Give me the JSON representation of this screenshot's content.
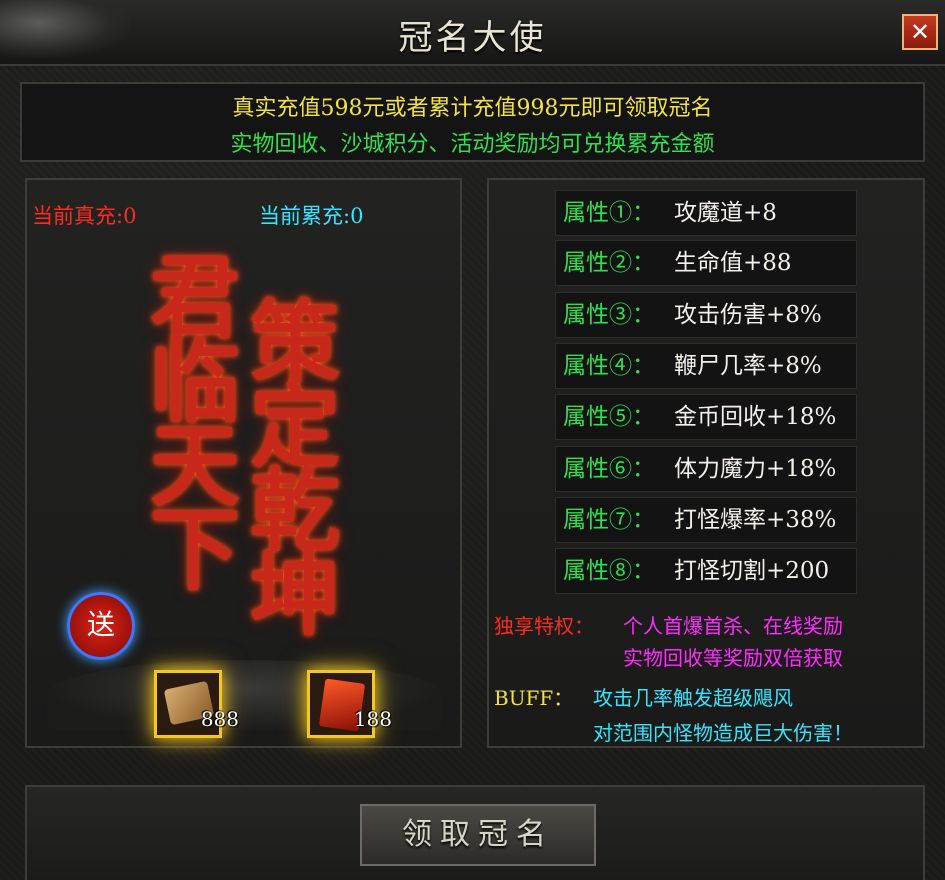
{
  "window": {
    "title": "冠名大使",
    "close_label": "✕"
  },
  "notice": {
    "line1": "真实充值598元或者累计充值998元即可领取冠名",
    "line2": "实物回收、沙城积分、活动奖励均可兑换累充金额"
  },
  "left_panel": {
    "current_real_recharge": "当前真充:0",
    "current_total_recharge": "当前累充:0",
    "calligraphy_line1": "君临天下",
    "calligraphy_line2": "策定乾坤",
    "gift_badge": "送",
    "items": [
      {
        "name": "scroll-item",
        "count": "888"
      },
      {
        "name": "red-book-item",
        "count": "188"
      }
    ]
  },
  "attributes": [
    {
      "label": "属性①：",
      "value": "攻魔道+8"
    },
    {
      "label": "属性②：",
      "value": "生命值+88"
    },
    {
      "label": "属性③：",
      "value": "攻击伤害+8%"
    },
    {
      "label": "属性④：",
      "value": "鞭尸几率+8%"
    },
    {
      "label": "属性⑤：",
      "value": "金币回收+18%"
    },
    {
      "label": "属性⑥：",
      "value": "体力魔力+18%"
    },
    {
      "label": "属性⑦：",
      "value": "打怪爆率+38%"
    },
    {
      "label": "属性⑧：",
      "value": "打怪切割+200"
    }
  ],
  "privilege": {
    "label": "独享特权：",
    "line1": "个人首爆首杀、在线奖励",
    "line2": "实物回收等奖励双倍获取"
  },
  "buff": {
    "label": "BUFF：",
    "line1": "攻击几率触发超级飓风",
    "line2": "对范围内怪物造成巨大伤害！"
  },
  "claim_button": "领取冠名"
}
